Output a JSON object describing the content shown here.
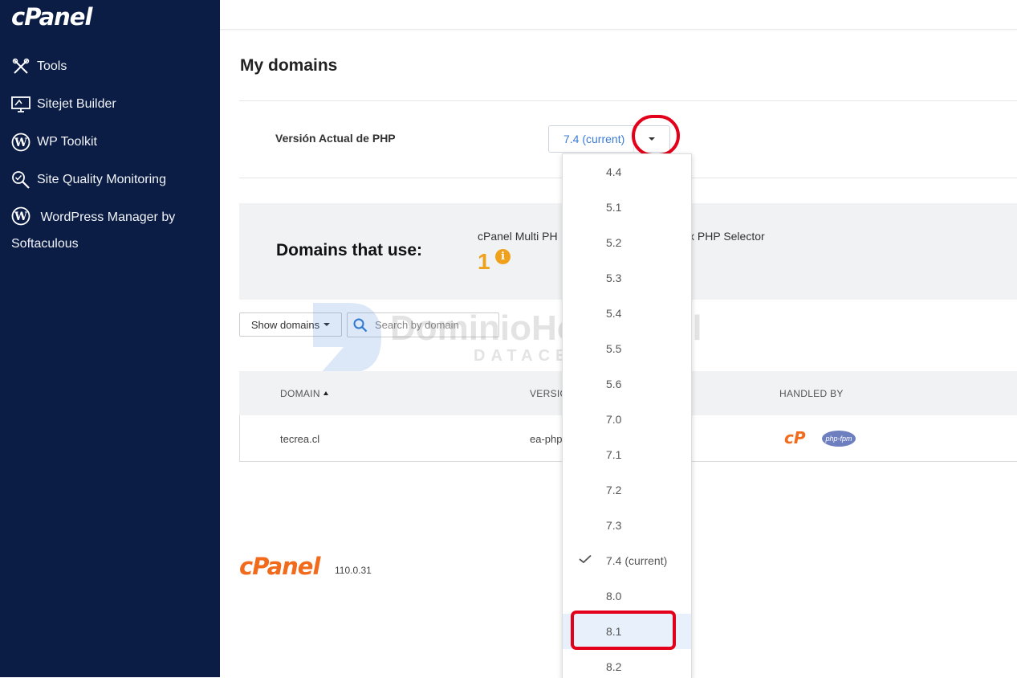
{
  "sidebar": {
    "logo": "cPanel",
    "items": [
      {
        "label": "Tools",
        "icon": "tools-icon"
      },
      {
        "label": "Sitejet Builder",
        "icon": "monitor-icon"
      },
      {
        "label": "WP Toolkit",
        "icon": "wordpress-icon"
      },
      {
        "label": "Site Quality Monitoring",
        "icon": "magnifier-check-icon"
      },
      {
        "label": "WordPress Manager by Softaculous",
        "icon": "wordpress-icon"
      }
    ]
  },
  "main": {
    "title": "My domains",
    "php_version_label": "Versión Actual de PHP",
    "php_version_value": "7.4 (current)",
    "domains_use_title": "Domains that use:",
    "multi_php_label": "cPanel Multi PH",
    "selector_label": "x PHP Selector",
    "domain_count": "1",
    "show_domains": "Show domains",
    "search_placeholder": "Search by domain",
    "watermark": {
      "brand": "DominioHosting.cl",
      "sub": "DATACENTER"
    }
  },
  "table": {
    "headers": {
      "domain": "DOMAIN",
      "version": "VERSIO",
      "handled_by": "HANDLED BY"
    },
    "rows": [
      {
        "domain": "tecrea.cl",
        "version": "ea-php",
        "handled_by_icons": [
          "cpanel-icon",
          "php-fpm-icon"
        ],
        "cpanel_text": "cP",
        "phpfpm_text": "php-fpm"
      }
    ]
  },
  "footer": {
    "logo": "cPanel",
    "version": "110.0.31"
  },
  "dropdown": {
    "options": [
      "4.4",
      "5.1",
      "5.2",
      "5.3",
      "5.4",
      "5.5",
      "5.6",
      "7.0",
      "7.1",
      "7.2",
      "7.3",
      "7.4 (current)",
      "8.0",
      "8.1",
      "8.2"
    ],
    "selected": "7.4 (current)",
    "hovered": "8.1"
  },
  "colors": {
    "sidebar_bg": "#0b1d45",
    "accent_orange": "#f26a1b",
    "count_orange": "#f0a11c",
    "link_blue": "#3a7bd5",
    "annotation_red": "#e3001a"
  }
}
